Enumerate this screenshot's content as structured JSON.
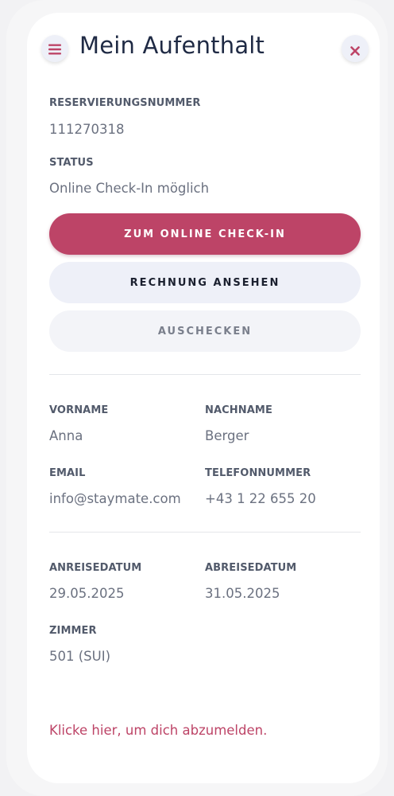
{
  "header": {
    "title": "Mein Aufenthalt",
    "menu_icon": "hamburger-menu-icon",
    "close_icon": "close-icon"
  },
  "reservation": {
    "number_label": "RESERVIERUNGSNUMMER",
    "number_value": "111270318",
    "status_label": "STATUS",
    "status_value": "Online Check-In möglich"
  },
  "actions": {
    "checkin_label": "ZUM ONLINE CHECK-IN",
    "invoice_label": "RECHNUNG ANSEHEN",
    "checkout_label": "AUSCHECKEN"
  },
  "guest": {
    "firstname_label": "VORNAME",
    "firstname_value": "Anna",
    "lastname_label": "NACHNAME",
    "lastname_value": "Berger",
    "email_label": "EMAIL",
    "email_value": "info@staymate.com",
    "phone_label": "TELEFONNUMMER",
    "phone_value": "+43 1 22 655 20"
  },
  "stay": {
    "arrival_label": "ANREISEDATUM",
    "arrival_value": "29.05.2025",
    "departure_label": "ABREISEDATUM",
    "departure_value": "31.05.2025",
    "room_label": "ZIMMER",
    "room_value": "501 (SUI)"
  },
  "footer": {
    "logout_link": "Klicke hier, um dich abzumelden."
  },
  "colors": {
    "accent": "#bd4467",
    "text_dark": "#1f2a44",
    "label": "#525a6b",
    "value": "#6b7180",
    "button_light": "#eef0f8"
  }
}
